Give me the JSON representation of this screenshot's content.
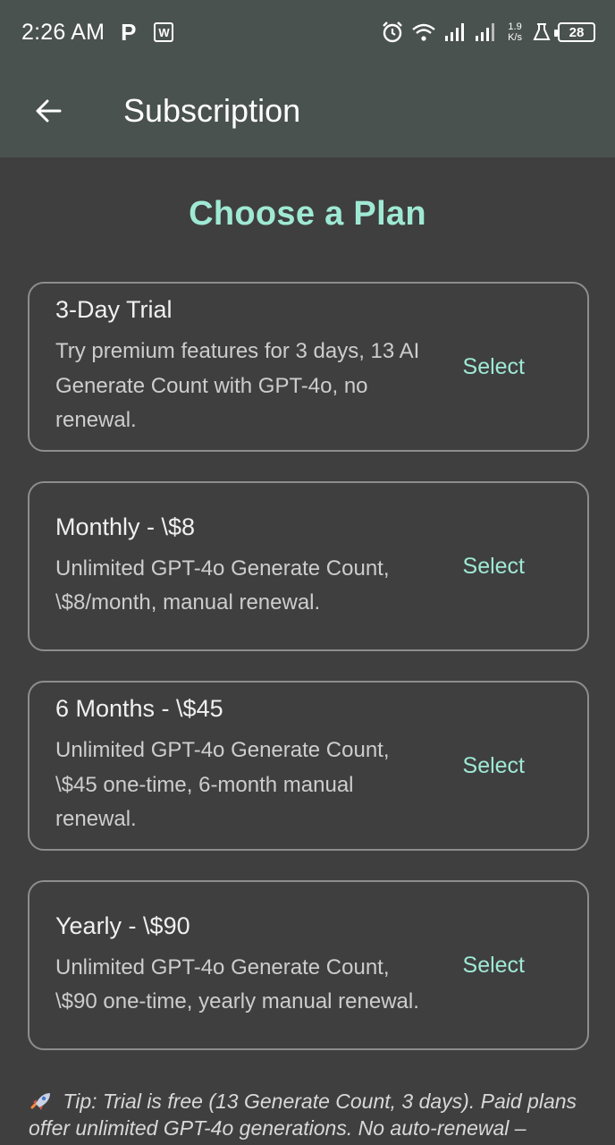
{
  "status_bar": {
    "time": "2:26 AM",
    "p_icon_label": "P",
    "speed_value": "1.9",
    "speed_unit": "K/s",
    "battery": "28"
  },
  "app_bar": {
    "title": "Subscription"
  },
  "heading": "Choose a Plan",
  "plans": [
    {
      "title": "3-Day Trial",
      "description": "Try premium features for 3 days, 13 AI Generate Count with GPT-4o, no renewal.",
      "action": "Select"
    },
    {
      "title": "Monthly - \\$8",
      "description": "Unlimited GPT-4o Generate Count, \\$8/month, manual renewal.",
      "action": "Select"
    },
    {
      "title": "6 Months - \\$45",
      "description": "Unlimited GPT-4o Generate Count, \\$45 one-time, 6-month manual renewal.",
      "action": "Select"
    },
    {
      "title": "Yearly - \\$90",
      "description": "Unlimited GPT-4o Generate Count, \\$90 one-time, yearly manual renewal.",
      "action": "Select"
    }
  ],
  "tip": {
    "icon": "rocket-icon",
    "text": "Tip: Trial is free (13 Generate Count, 3 days). Paid plans offer unlimited GPT-4o generations. No auto-renewal –"
  },
  "colors": {
    "accent": "#9fe9d4",
    "background": "#3f3f3f",
    "app_bar": "#4a5250",
    "card_border": "#8d8d8d"
  }
}
